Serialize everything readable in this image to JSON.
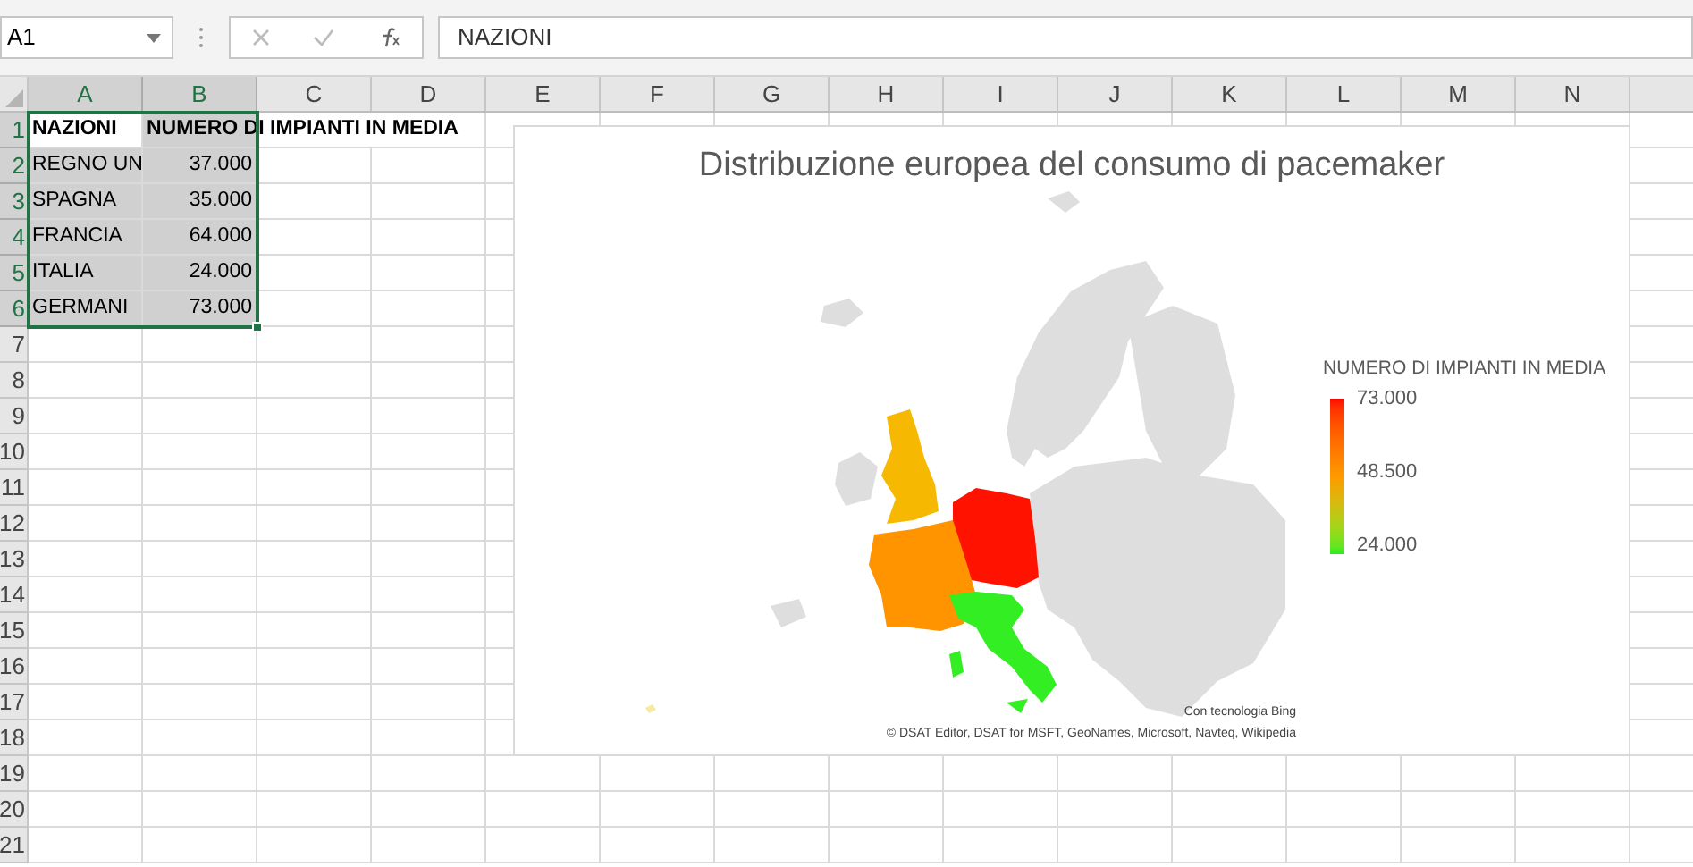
{
  "formula_bar": {
    "name_box": "A1",
    "formula": "NAZIONI"
  },
  "columns": [
    {
      "label": "A",
      "selected": true
    },
    {
      "label": "B",
      "selected": true
    },
    {
      "label": "C",
      "selected": false
    },
    {
      "label": "D",
      "selected": false
    },
    {
      "label": "E",
      "selected": false
    },
    {
      "label": "F",
      "selected": false
    },
    {
      "label": "G",
      "selected": false
    },
    {
      "label": "H",
      "selected": false
    },
    {
      "label": "I",
      "selected": false
    },
    {
      "label": "J",
      "selected": false
    },
    {
      "label": "K",
      "selected": false
    },
    {
      "label": "L",
      "selected": false
    },
    {
      "label": "M",
      "selected": false
    },
    {
      "label": "N",
      "selected": false
    }
  ],
  "rows": [
    {
      "number": "1",
      "selected": true,
      "cells": [
        {
          "text": "NAZIONI",
          "kind": "header",
          "selected": false
        },
        {
          "text": "NUMERO DI IMPIANTI IN MEDIA",
          "kind": "header",
          "selected": true
        }
      ]
    },
    {
      "number": "2",
      "selected": true,
      "cells": [
        {
          "text": "REGNO UN",
          "kind": "text",
          "selected": true
        },
        {
          "text": "37.000",
          "kind": "number",
          "selected": true
        }
      ]
    },
    {
      "number": "3",
      "selected": true,
      "cells": [
        {
          "text": "SPAGNA",
          "kind": "text",
          "selected": true
        },
        {
          "text": "35.000",
          "kind": "number",
          "selected": true
        }
      ]
    },
    {
      "number": "4",
      "selected": true,
      "cells": [
        {
          "text": "FRANCIA",
          "kind": "text",
          "selected": true
        },
        {
          "text": "64.000",
          "kind": "number",
          "selected": true
        }
      ]
    },
    {
      "number": "5",
      "selected": true,
      "cells": [
        {
          "text": "ITALIA",
          "kind": "text",
          "selected": true
        },
        {
          "text": "24.000",
          "kind": "number",
          "selected": true
        }
      ]
    },
    {
      "number": "6",
      "selected": true,
      "cells": [
        {
          "text": "GERMANI",
          "kind": "text",
          "selected": true
        },
        {
          "text": "73.000",
          "kind": "number",
          "selected": true
        }
      ]
    },
    {
      "number": "7",
      "selected": false,
      "cells": []
    },
    {
      "number": "8",
      "selected": false,
      "cells": []
    },
    {
      "number": "9",
      "selected": false,
      "cells": []
    },
    {
      "number": "10",
      "selected": false,
      "cells": []
    },
    {
      "number": "11",
      "selected": false,
      "cells": []
    },
    {
      "number": "12",
      "selected": false,
      "cells": []
    },
    {
      "number": "13",
      "selected": false,
      "cells": []
    },
    {
      "number": "14",
      "selected": false,
      "cells": []
    },
    {
      "number": "15",
      "selected": false,
      "cells": []
    },
    {
      "number": "16",
      "selected": false,
      "cells": []
    },
    {
      "number": "17",
      "selected": false,
      "cells": []
    },
    {
      "number": "18",
      "selected": false,
      "cells": []
    },
    {
      "number": "19",
      "selected": false,
      "cells": []
    },
    {
      "number": "20",
      "selected": false,
      "cells": []
    },
    {
      "number": "21",
      "selected": false,
      "cells": []
    }
  ],
  "chart": {
    "title": "Distribuzione europea del consumo di pacemaker",
    "legend": {
      "title": "NUMERO DI IMPIANTI IN MEDIA",
      "labels": [
        "73.000",
        "48.500",
        "24.000"
      ]
    },
    "credits": [
      "Con tecnologia Bing",
      "© DSAT Editor, DSAT for MSFT, GeoNames, Microsoft, Navteq, Wikipedia"
    ]
  }
}
